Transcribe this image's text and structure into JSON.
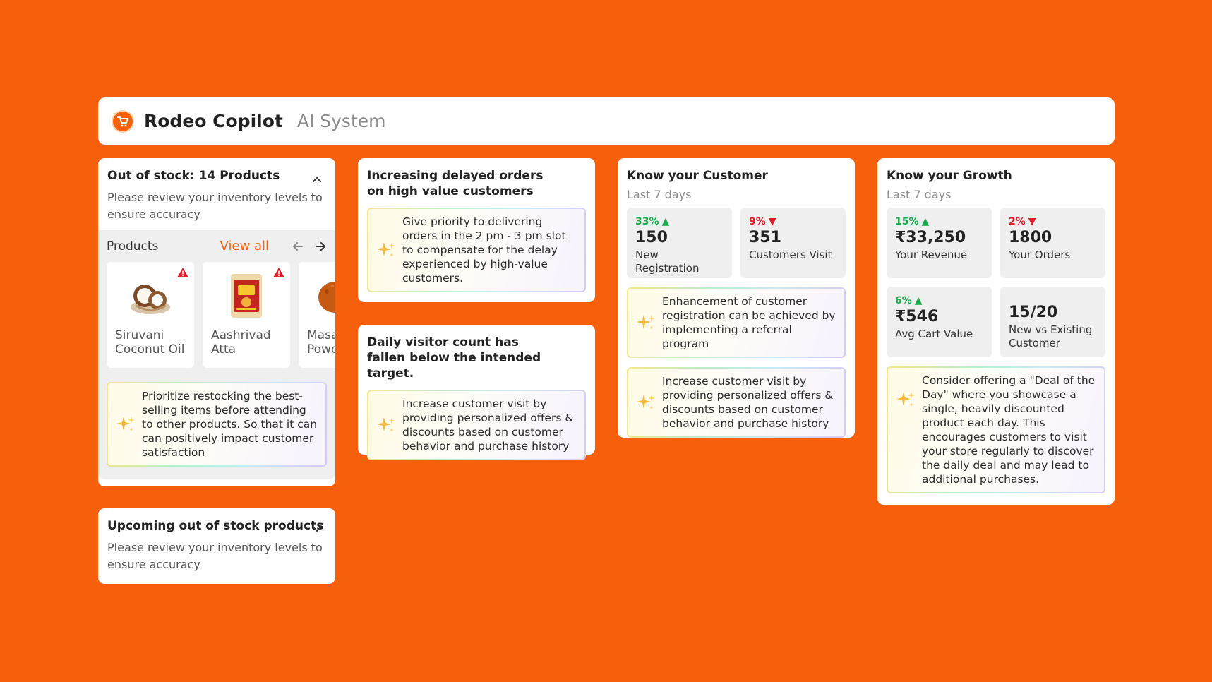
{
  "header": {
    "title": "Rodeo Copilot",
    "subtitle": "AI System",
    "logo_icon": "cart-icon"
  },
  "colors": {
    "brand": "#F6600C",
    "up": "#1ba94c",
    "down": "#e3192c"
  },
  "out_of_stock": {
    "title": "Out of stock: 14 Products",
    "desc": "Please review your inventory levels to ensure accuracy",
    "products_label": "Products",
    "view_all": "View all",
    "products": [
      {
        "name": "Siruvani Coconut Oil",
        "icon": "coconut-image"
      },
      {
        "name": "Aashrivad Atta",
        "icon": "atta-bag-image"
      },
      {
        "name": "Masala Powder",
        "icon": "masala-powder-image"
      }
    ],
    "insight": "Prioritize restocking the best-selling items before attending to other products. So that it can can positively impact customer satisfaction"
  },
  "upcoming": {
    "title": "Upcoming out of stock products",
    "desc": "Please review your inventory levels to ensure accuracy"
  },
  "delayed": {
    "title": "Increasing delayed orders on high value customers",
    "insight": "Give priority to delivering orders in the 2 pm - 3 pm slot to compensate for the delay experienced by high-value customers."
  },
  "visitor": {
    "title": "Daily visitor count has fallen below the intended target.",
    "insight": "Increase customer visit by providing personalized offers & discounts based on customer behavior and purchase history"
  },
  "customer": {
    "title": "Know your Customer",
    "period": "Last 7 days",
    "stats": [
      {
        "pct": "33%",
        "dir": "up",
        "value": "150",
        "label": "New Registration"
      },
      {
        "pct": "9%",
        "dir": "down",
        "value": "351",
        "label": "Customers Visit"
      }
    ],
    "insights": [
      "Enhancement of customer registration can be achieved by implementing a referral program",
      "Increase customer visit by providing personalized offers & discounts based on customer behavior and purchase history"
    ]
  },
  "growth": {
    "title": "Know your Growth",
    "period": "Last 7 days",
    "stats": [
      {
        "pct": "15%",
        "dir": "up",
        "value": "₹33,250",
        "label": "Your Revenue"
      },
      {
        "pct": "2%",
        "dir": "down",
        "value": "1800",
        "label": "Your Orders"
      },
      {
        "pct": "6%",
        "dir": "up",
        "value": "₹546",
        "label": "Avg Cart Value"
      },
      {
        "pct": "",
        "dir": "",
        "value": "15/20",
        "label": "New vs Existing Customer"
      }
    ],
    "insight": "Consider offering a \"Deal of the Day\" where you showcase a single, heavily discounted product each day. This encourages customers to visit your store regularly to discover the daily deal and may lead to additional purchases."
  }
}
